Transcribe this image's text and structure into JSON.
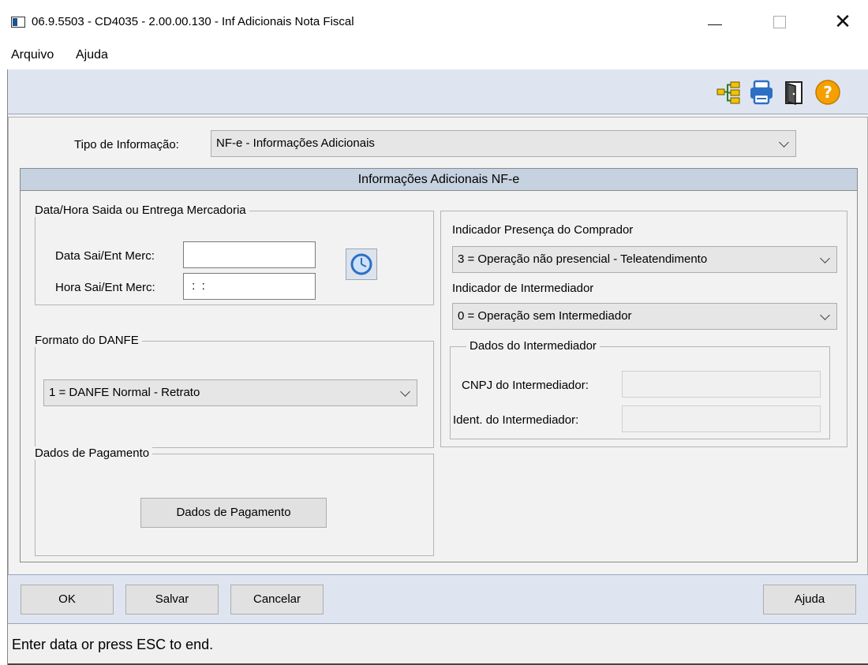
{
  "window": {
    "title": "06.9.5503 - CD4035 - 2.00.00.130 - Inf Adicionais Nota Fiscal",
    "close_glyph": "✕"
  },
  "menu": {
    "items": [
      "Arquivo",
      "Ajuda"
    ]
  },
  "toolbar": {
    "icons": [
      "tree-structure-icon",
      "printer-icon",
      "exit-door-icon",
      "help-icon"
    ]
  },
  "form": {
    "tipo_label": "Tipo de Informação:",
    "tipo_value": "NF-e - Informações Adicionais",
    "panel_title": "Informações Adicionais NF-e",
    "data_hora_group": {
      "title": "Data/Hora Saida ou Entrega Mercadoria",
      "data_label": "Data Sai/Ent Merc:",
      "data_value": "",
      "hora_label": "Hora Sai/Ent Merc:",
      "hora_value": " :  :"
    },
    "danfe_group": {
      "title": "Formato do DANFE",
      "value": "1 = DANFE Normal - Retrato"
    },
    "pagamento_group": {
      "title": "Dados de Pagamento",
      "button_label": "Dados de Pagamento"
    },
    "presenca": {
      "label": "Indicador Presença do Comprador",
      "value": "3 = Operação não presencial - Teleatendimento"
    },
    "intermediador": {
      "label": "Indicador de Intermediador",
      "value": "0 = Operação sem Intermediador"
    },
    "dados_intermediador": {
      "title": "Dados do Intermediador",
      "cnpj_label": "CNPJ do Intermediador:",
      "cnpj_value": "",
      "ident_label": "Ident. do Intermediador:",
      "ident_value": ""
    }
  },
  "buttons": {
    "ok": "OK",
    "salvar": "Salvar",
    "cancelar": "Cancelar",
    "ajuda": "Ajuda"
  },
  "status": {
    "text": "Enter data or press ESC to end."
  },
  "colors": {
    "toolbar_bg": "#dfe5f0",
    "panel_header_bg": "#c6d2e0",
    "help_orange": "#f5a000",
    "icon_blue": "#2c6fc4"
  }
}
